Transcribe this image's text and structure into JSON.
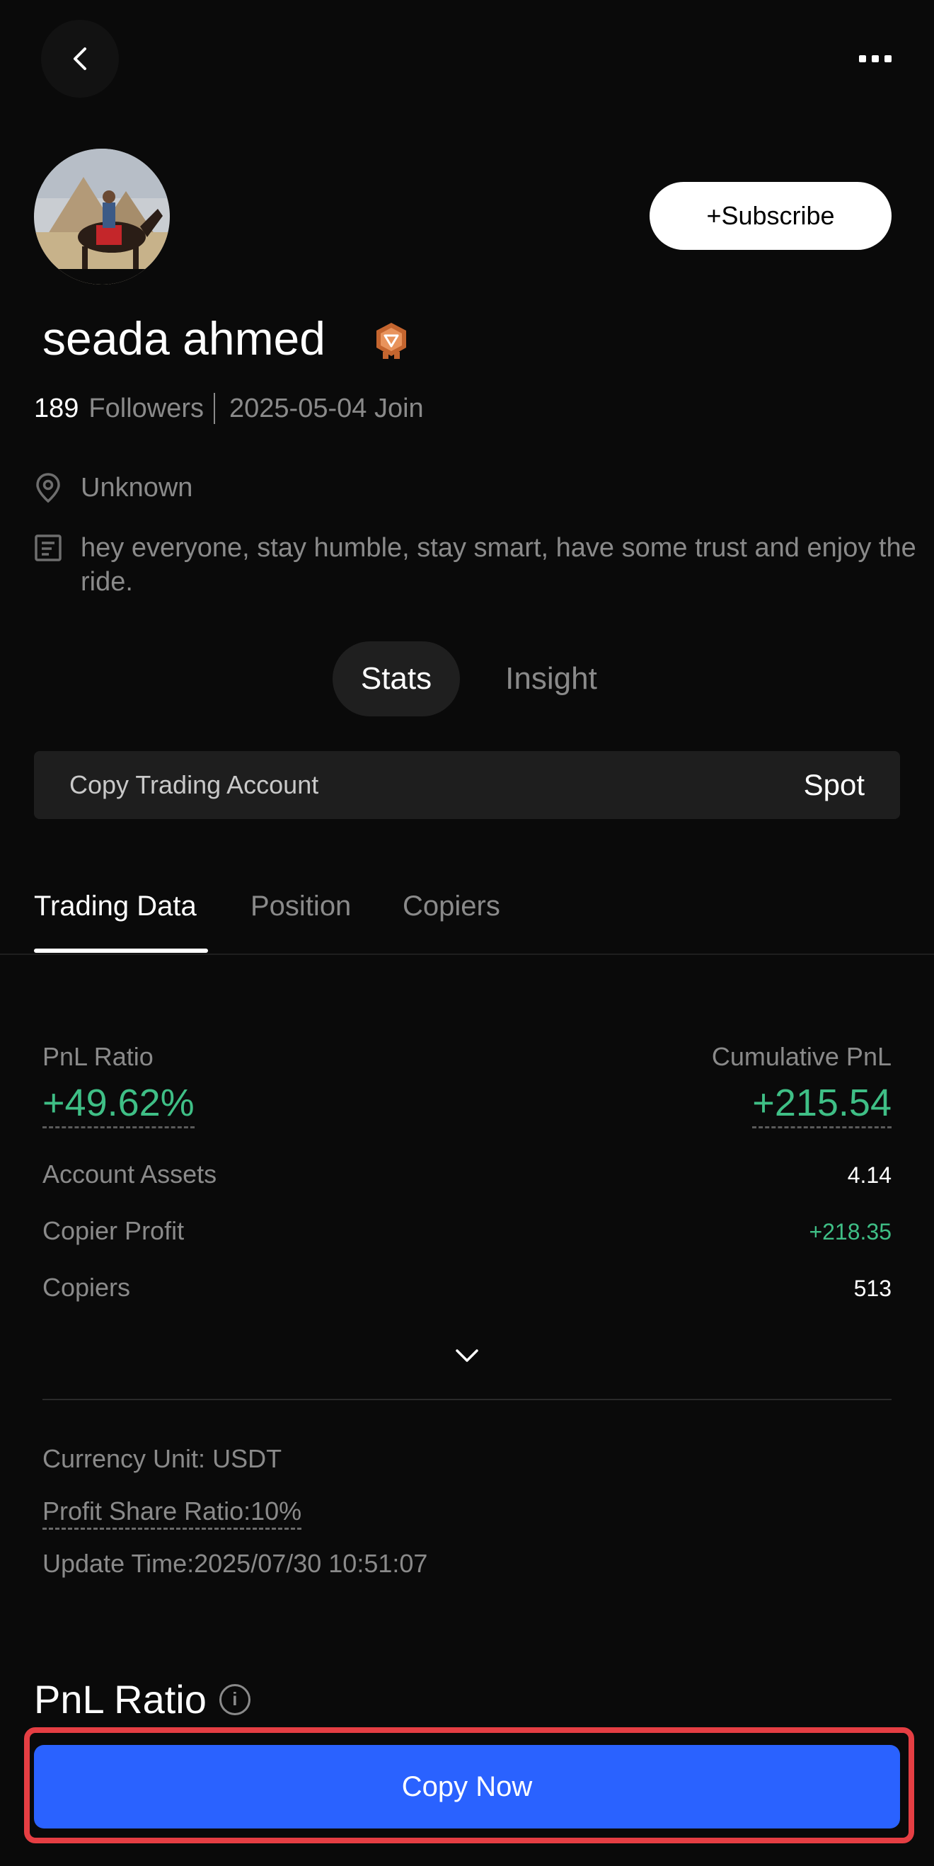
{
  "header": {
    "back_icon": "chevron-left-icon",
    "more_icon": "more-horizontal-icon"
  },
  "profile": {
    "name": "seada ahmed",
    "badge_icon": "rank-badge-icon",
    "subscribe_label": "+Subscribe",
    "followers_count": "189",
    "followers_label": "Followers",
    "join_text": "2025-05-04 Join",
    "location": "Unknown",
    "bio": "hey everyone, stay humble, stay smart, have some trust and enjoy the ride."
  },
  "segments": {
    "items": [
      {
        "label": "Stats",
        "active": true
      },
      {
        "label": "Insight",
        "active": false
      }
    ]
  },
  "account": {
    "label": "Copy Trading Account",
    "value": "Spot"
  },
  "tabs": {
    "items": [
      {
        "label": "Trading Data",
        "active": true
      },
      {
        "label": "Position",
        "active": false
      },
      {
        "label": "Copiers",
        "active": false
      }
    ]
  },
  "trading_data": {
    "pnl_ratio_label": "PnL Ratio",
    "pnl_ratio_value": "+49.62%",
    "cumulative_pnl_label": "Cumulative PnL",
    "cumulative_pnl_value": "+215.54",
    "rows": [
      {
        "label": "Account Assets",
        "value": "4.14"
      },
      {
        "label": "Copier Profit",
        "value": "+218.35"
      },
      {
        "label": "Copiers",
        "value": "513"
      }
    ],
    "currency_unit": "Currency Unit: USDT",
    "profit_share": "Profit Share Ratio:10%",
    "update_time": "Update Time:2025/07/30 10:51:07"
  },
  "section": {
    "title": "PnL Ratio"
  },
  "footer": {
    "copy_label": "Copy Now"
  },
  "colors": {
    "background": "#0a0a0a",
    "positive": "#3fbf86",
    "primary_button": "#2a62ff",
    "highlight_frame": "#e53e43"
  }
}
